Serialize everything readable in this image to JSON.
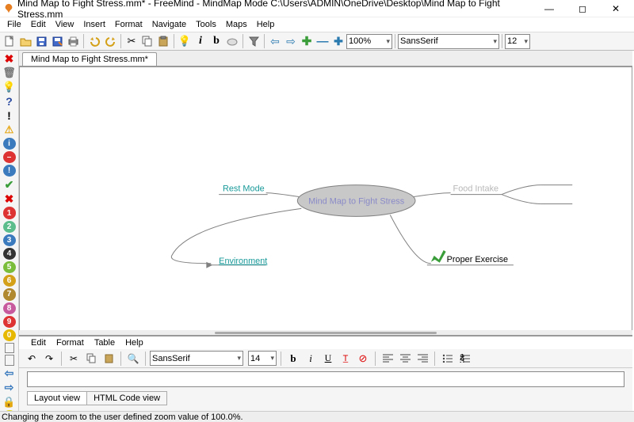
{
  "window": {
    "title": "Mind Map to Fight Stress.mm* - FreeMind - MindMap Mode C:\\Users\\ADMIN\\OneDrive\\Desktop\\Mind Map to Fight Stress.mm"
  },
  "main_menu": [
    "File",
    "Edit",
    "View",
    "Insert",
    "Format",
    "Navigate",
    "Tools",
    "Maps",
    "Help"
  ],
  "toolbar": {
    "zoom": "100%",
    "font": "SansSerif",
    "size": "12"
  },
  "tab": {
    "label": "Mind Map to Fight Stress.mm*"
  },
  "mindmap": {
    "root": "Mind Map to Fight Stress",
    "nodes": {
      "rest": "Rest Mode",
      "env": "Environment",
      "food": "Food Intake",
      "exercise": "Proper Exercise"
    }
  },
  "editor": {
    "menu": [
      "Edit",
      "Format",
      "Table",
      "Help"
    ],
    "font": "SansSerif",
    "size": "14",
    "tabs": {
      "layout": "Layout view",
      "html": "HTML Code view"
    }
  },
  "status": "Changing the zoom to the user defined zoom value of 100.0%."
}
